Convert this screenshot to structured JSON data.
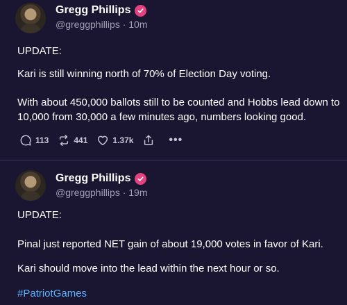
{
  "posts": [
    {
      "author": "Gregg Phillips",
      "handle": "@greggphillips",
      "time": "10m",
      "meta": "@greggphillips · 10m",
      "paragraphs": [
        "UPDATE:",
        "Kari is still winning north of 70% of Election Day voting.",
        "With about 450,000 ballots still to be counted and Hobbs lead down to 10,000 from 30,000 a few minutes ago, numbers looking good."
      ],
      "stats": {
        "replies": "113",
        "reposts": "441",
        "likes": "1.37k"
      }
    },
    {
      "author": "Gregg Phillips",
      "handle": "@greggphillips",
      "time": "19m",
      "meta": "@greggphillips · 19m",
      "paragraphs": [
        "UPDATE:",
        "Pinal just reported NET gain of about 19,000 votes in favor of Kari.",
        "Kari should move into the lead within the next hour or so."
      ],
      "hashtag": "#PatriotGames"
    }
  ],
  "icons": {
    "verified": "verified-badge-icon",
    "reply": "reply-icon",
    "repost": "repost-icon",
    "like": "heart-icon",
    "share": "share-icon",
    "more": "more-icon"
  },
  "colors": {
    "background": "#1a1530",
    "verified_badge": "#e2437f",
    "hashtag": "#5ab2ff",
    "muted_text": "#a49fb6"
  }
}
